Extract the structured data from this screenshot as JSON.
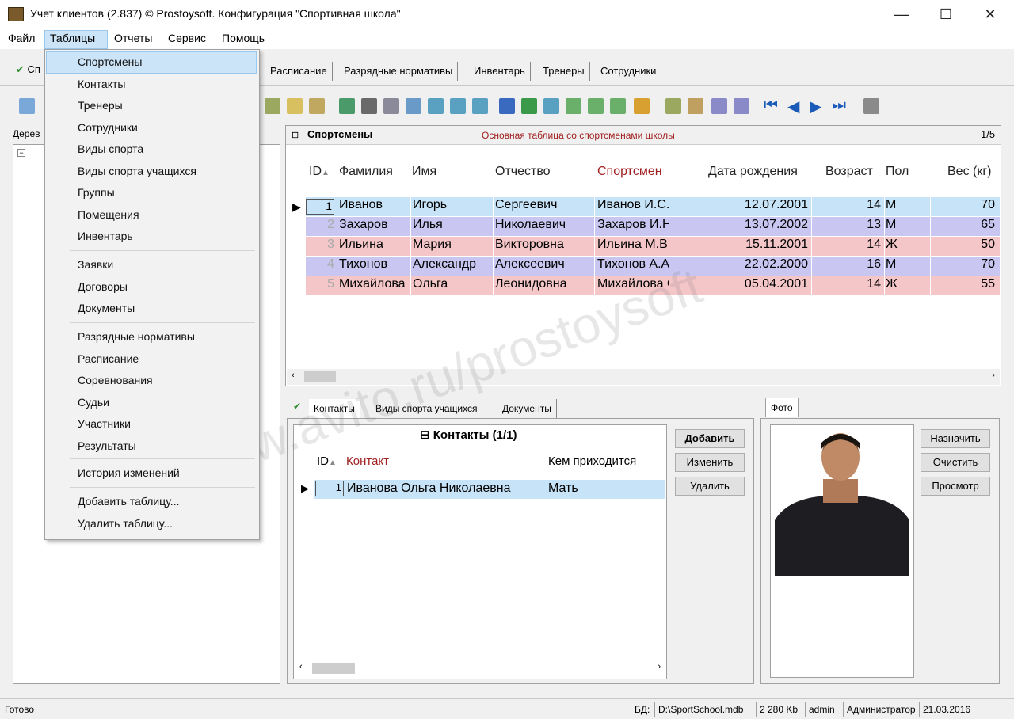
{
  "window": {
    "title": "Учет клиентов (2.837) © Prostoysoft. Конфигурация \"Спортивная школа\"",
    "minimize": "—",
    "maximize": "☐",
    "close": "✕"
  },
  "menubar": [
    "Файл",
    "Таблицы",
    "Отчеты",
    "Сервис",
    "Помощь"
  ],
  "tabs": [
    "Расписание",
    "Разрядные нормативы",
    "Инвентарь",
    "Тренеры",
    "Сотрудники"
  ],
  "first_tab_fragment": "Сп",
  "dropdown": {
    "group1": [
      "Спортсмены",
      "Контакты",
      "Тренеры",
      "Сотрудники",
      "Виды спорта",
      "Виды спорта учащихся",
      "Группы",
      "Помещения",
      "Инвентарь"
    ],
    "group2": [
      "Заявки",
      "Договоры",
      "Документы"
    ],
    "group3": [
      "Разрядные нормативы",
      "Расписание",
      "Соревнования",
      "Судьи",
      "Участники",
      "Результаты"
    ],
    "group4": [
      "История изменений"
    ],
    "group5": [
      "Добавить таблицу...",
      "Удалить таблицу..."
    ]
  },
  "tree_label": "Дерев",
  "grid": {
    "title": "Спортсмены",
    "description": "Основная таблица со спортсменами школы",
    "page": "1/5",
    "columns": [
      "ID",
      "Фамилия",
      "Имя",
      "Отчество",
      "Спортсмен",
      "Дата рождения",
      "Возраст",
      "Пол",
      "Вес (кг)"
    ],
    "rows": [
      {
        "id": "1",
        "last": "Иванов",
        "first": "Игорь",
        "middle": "Сергеевич",
        "full": "Иванов И.С.",
        "dob": "12.07.2001",
        "age": "14",
        "sex": "М",
        "weight": "70",
        "color": "#c6e3f7"
      },
      {
        "id": "2",
        "last": "Захаров",
        "first": "Илья",
        "middle": "Николаевич",
        "full": "Захаров И.Н.",
        "dob": "13.07.2002",
        "age": "13",
        "sex": "М",
        "weight": "65",
        "color": "#c9c6f2"
      },
      {
        "id": "3",
        "last": "Ильина",
        "first": "Мария",
        "middle": "Викторовна",
        "full": "Ильина М.В.",
        "dob": "15.11.2001",
        "age": "14",
        "sex": "Ж",
        "weight": "50",
        "color": "#f4c6c8"
      },
      {
        "id": "4",
        "last": "Тихонов",
        "first": "Александр",
        "middle": "Алексеевич",
        "full": "Тихонов А.А.",
        "dob": "22.02.2000",
        "age": "16",
        "sex": "М",
        "weight": "70",
        "color": "#c9c6f2"
      },
      {
        "id": "5",
        "last": "Михайлова",
        "first": "Ольга",
        "middle": "Леонидовна",
        "full": "Михайлова О.Л.",
        "dob": "05.04.2001",
        "age": "14",
        "sex": "Ж",
        "weight": "55",
        "color": "#f4c6c8"
      }
    ]
  },
  "bottom_tabs": [
    "Контакты",
    "Виды спорта учащихся",
    "Документы"
  ],
  "contacts": {
    "title": "Контакты (1/1)",
    "columns": [
      "ID",
      "Контакт",
      "Кем приходится"
    ],
    "rows": [
      {
        "id": "1",
        "name": "Иванова Ольга Николаевна",
        "relation": "Мать"
      }
    ],
    "buttons": [
      "Добавить",
      "Изменить",
      "Удалить"
    ]
  },
  "photo": {
    "tab": "Фото",
    "buttons": [
      "Назначить",
      "Очистить",
      "Просмотр"
    ]
  },
  "statusbar": {
    "ready": "Готово",
    "db_label": "БД:",
    "db_path": "D:\\SportSchool.mdb",
    "size": "2 280 Kb",
    "user": "admin",
    "role": "Администратор",
    "date": "21.03.2016"
  },
  "watermark": "www.avito.ru/prostoysoft",
  "colors": {
    "menu_highlight": "#cce4f7",
    "accent_red": "#a02020"
  }
}
